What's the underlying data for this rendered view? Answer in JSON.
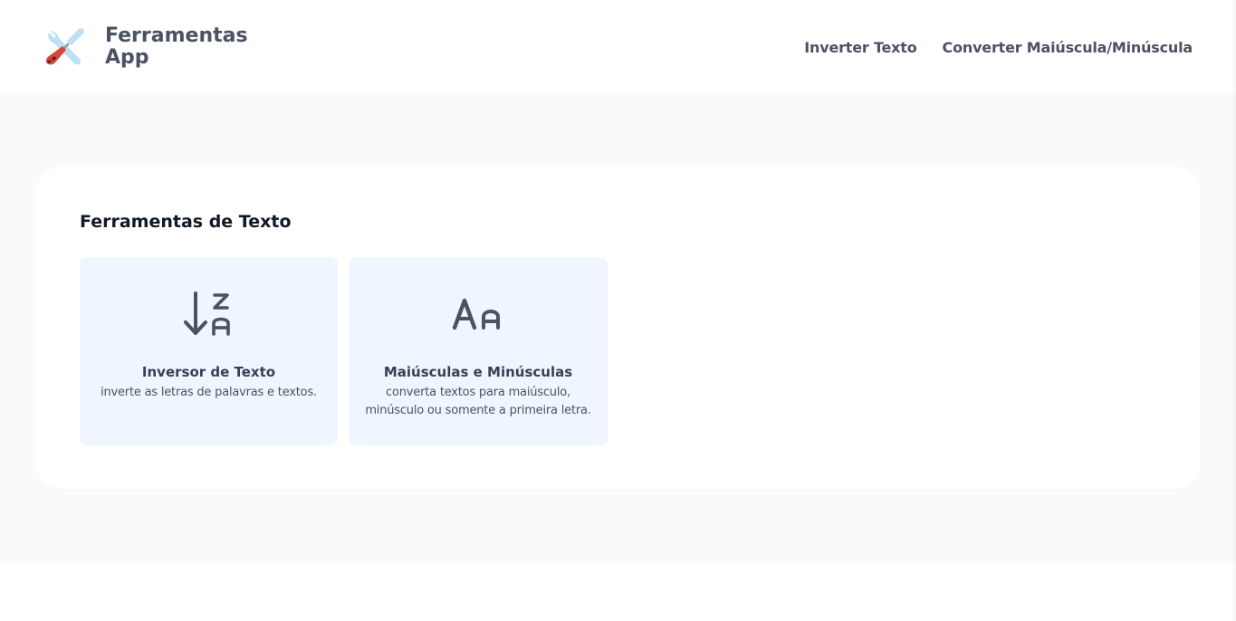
{
  "header": {
    "brand_line1": "Ferramentas",
    "brand_line2": "App",
    "logo_icon": "tools-icon",
    "nav": [
      {
        "label": "Inverter Texto"
      },
      {
        "label": "Converter Maiúscula/Minúscula"
      }
    ]
  },
  "main": {
    "section_title": "Ferramentas de Texto",
    "cards": [
      {
        "icon": "sort-z-a-icon",
        "title": "Inversor de Texto",
        "desc": "inverte as letras de palavras e textos."
      },
      {
        "icon": "letter-case-icon",
        "title": "Maiúsculas e Minúsculas",
        "desc": "converta textos para maiúsculo, minúsculo ou somente a primeira letra."
      }
    ]
  },
  "colors": {
    "nav_text": "#4b5263",
    "main_bg": "#f8fafc",
    "card_bg": "#eff6ff",
    "logo_light_blue": "#bde0f5",
    "logo_red": "#d9453b"
  }
}
